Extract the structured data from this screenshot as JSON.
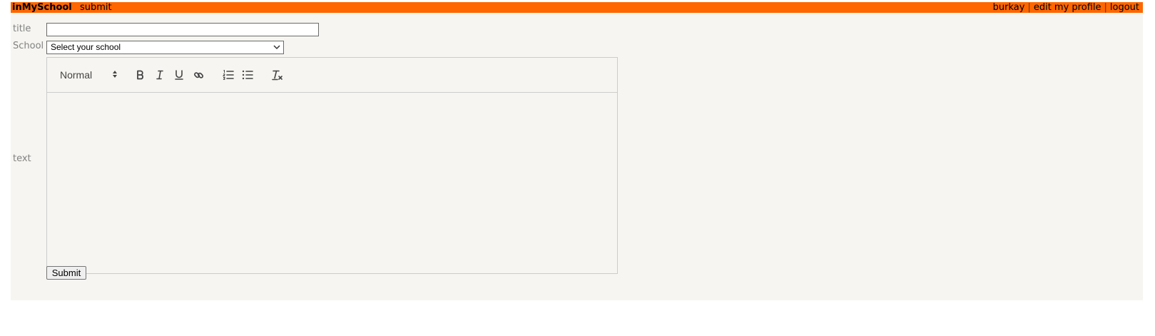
{
  "header": {
    "brand": "inMySchool",
    "submit_link": "submit",
    "username": "burkay",
    "edit_profile": "edit my profile",
    "logout": "logout",
    "separator": "|"
  },
  "form": {
    "title_label": "title",
    "title_value": "",
    "school_label": "School",
    "school_selected": "Select your school",
    "text_label": "text",
    "editor": {
      "heading_value": "Normal",
      "content": "",
      "icons": [
        "bold-icon",
        "italic-icon",
        "underline-icon",
        "link-icon",
        "ordered-list-icon",
        "bullet-list-icon",
        "clear-format-icon"
      ]
    },
    "submit_label": "Submit"
  },
  "colors": {
    "topbar": "#ff6600",
    "page_background": "#f6f5f1",
    "label_text": "#828282"
  }
}
